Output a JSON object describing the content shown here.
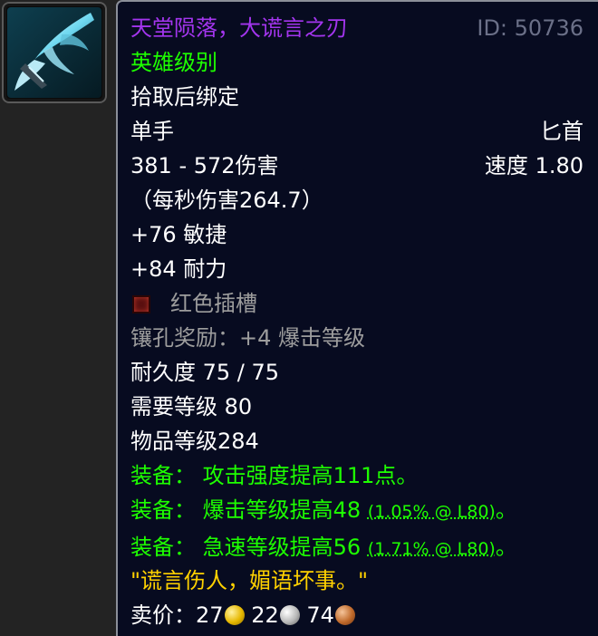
{
  "icon": {
    "name": "dagger-item-icon"
  },
  "item": {
    "name": "天堂陨落，大谎言之刃",
    "id_text": "ID: 50736",
    "quality": "英雄级别",
    "binding": "拾取后绑定",
    "slot": "单手",
    "weapon_type": "匕首",
    "damage": "381 - 572伤害",
    "speed": "速度 1.80",
    "dps": "（每秒伤害264.7）",
    "stat_agility": "+76 敏捷",
    "stat_stamina": "+84 耐力",
    "socket_label": "红色插槽",
    "socket_bonus": "镶孔奖励：+4 爆击等级",
    "durability": "耐久度 75 / 75",
    "required_level": "需要等级 80",
    "item_level": "物品等级284",
    "equip_1": "装备： 攻击强度提高111点。",
    "equip_2_text": "装备： 爆击等级提高48 ",
    "equip_2_detail": "(1.05% @ L80)",
    "equip_2_end": "。",
    "equip_3_text": "装备： 急速等级提高56 ",
    "equip_3_detail": "(1.71% @ L80)",
    "equip_3_end": "。",
    "flavor": "\"谎言伤人，媚语坏事。\"",
    "sell_label": "卖价：",
    "sell_gold": "27",
    "sell_silver": "22",
    "sell_copper": "74"
  },
  "colors": {
    "epic": "#a335ee",
    "uncommon": "#1eff00",
    "poor": "#9d9d9d",
    "flavor": "#ffd100",
    "background": "#070b20"
  }
}
